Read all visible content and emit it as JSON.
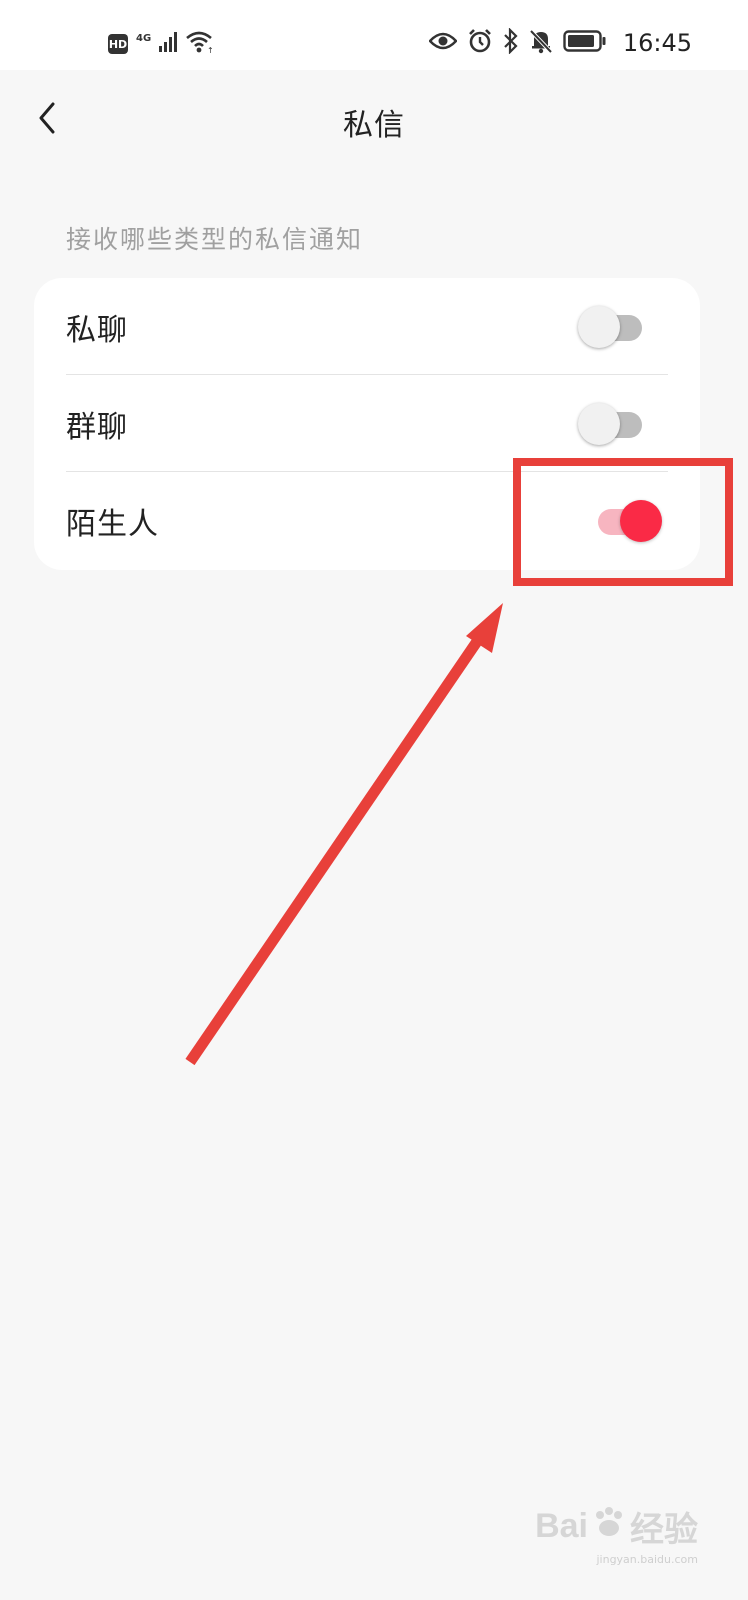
{
  "status_bar": {
    "badge": "HD",
    "network": "4G",
    "time": "16:45",
    "icons": [
      "hd-icon",
      "signal-icon",
      "wifi-icon",
      "eye-icon",
      "alarm-icon",
      "bluetooth-icon",
      "bell-off-icon",
      "battery-icon"
    ]
  },
  "header": {
    "title": "私信",
    "back_icon": "chevron-left-icon"
  },
  "section": {
    "label": "接收哪些类型的私信通知"
  },
  "settings": [
    {
      "label": "私聊",
      "toggle_on": false
    },
    {
      "label": "群聊",
      "toggle_on": false
    },
    {
      "label": "陌生人",
      "toggle_on": true
    }
  ],
  "colors": {
    "accent": "#fa2a46",
    "accent_track": "#f7b5c0",
    "annotation": "#e8403a",
    "page_bg": "#f7f7f7"
  },
  "watermark": {
    "brand": "Bai",
    "brand_suffix": "经验",
    "url": "jingyan.baidu.com"
  }
}
